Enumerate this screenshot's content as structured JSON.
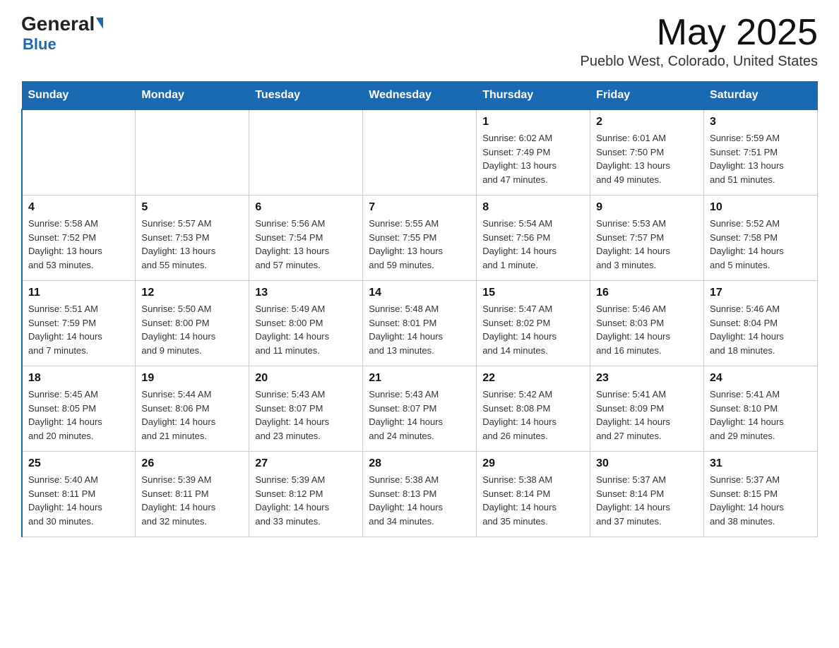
{
  "header": {
    "logo_general": "General",
    "logo_blue": "Blue",
    "month_title": "May 2025",
    "location": "Pueblo West, Colorado, United States"
  },
  "days_of_week": [
    "Sunday",
    "Monday",
    "Tuesday",
    "Wednesday",
    "Thursday",
    "Friday",
    "Saturday"
  ],
  "weeks": [
    [
      {
        "day": "",
        "info": ""
      },
      {
        "day": "",
        "info": ""
      },
      {
        "day": "",
        "info": ""
      },
      {
        "day": "",
        "info": ""
      },
      {
        "day": "1",
        "info": "Sunrise: 6:02 AM\nSunset: 7:49 PM\nDaylight: 13 hours\nand 47 minutes."
      },
      {
        "day": "2",
        "info": "Sunrise: 6:01 AM\nSunset: 7:50 PM\nDaylight: 13 hours\nand 49 minutes."
      },
      {
        "day": "3",
        "info": "Sunrise: 5:59 AM\nSunset: 7:51 PM\nDaylight: 13 hours\nand 51 minutes."
      }
    ],
    [
      {
        "day": "4",
        "info": "Sunrise: 5:58 AM\nSunset: 7:52 PM\nDaylight: 13 hours\nand 53 minutes."
      },
      {
        "day": "5",
        "info": "Sunrise: 5:57 AM\nSunset: 7:53 PM\nDaylight: 13 hours\nand 55 minutes."
      },
      {
        "day": "6",
        "info": "Sunrise: 5:56 AM\nSunset: 7:54 PM\nDaylight: 13 hours\nand 57 minutes."
      },
      {
        "day": "7",
        "info": "Sunrise: 5:55 AM\nSunset: 7:55 PM\nDaylight: 13 hours\nand 59 minutes."
      },
      {
        "day": "8",
        "info": "Sunrise: 5:54 AM\nSunset: 7:56 PM\nDaylight: 14 hours\nand 1 minute."
      },
      {
        "day": "9",
        "info": "Sunrise: 5:53 AM\nSunset: 7:57 PM\nDaylight: 14 hours\nand 3 minutes."
      },
      {
        "day": "10",
        "info": "Sunrise: 5:52 AM\nSunset: 7:58 PM\nDaylight: 14 hours\nand 5 minutes."
      }
    ],
    [
      {
        "day": "11",
        "info": "Sunrise: 5:51 AM\nSunset: 7:59 PM\nDaylight: 14 hours\nand 7 minutes."
      },
      {
        "day": "12",
        "info": "Sunrise: 5:50 AM\nSunset: 8:00 PM\nDaylight: 14 hours\nand 9 minutes."
      },
      {
        "day": "13",
        "info": "Sunrise: 5:49 AM\nSunset: 8:00 PM\nDaylight: 14 hours\nand 11 minutes."
      },
      {
        "day": "14",
        "info": "Sunrise: 5:48 AM\nSunset: 8:01 PM\nDaylight: 14 hours\nand 13 minutes."
      },
      {
        "day": "15",
        "info": "Sunrise: 5:47 AM\nSunset: 8:02 PM\nDaylight: 14 hours\nand 14 minutes."
      },
      {
        "day": "16",
        "info": "Sunrise: 5:46 AM\nSunset: 8:03 PM\nDaylight: 14 hours\nand 16 minutes."
      },
      {
        "day": "17",
        "info": "Sunrise: 5:46 AM\nSunset: 8:04 PM\nDaylight: 14 hours\nand 18 minutes."
      }
    ],
    [
      {
        "day": "18",
        "info": "Sunrise: 5:45 AM\nSunset: 8:05 PM\nDaylight: 14 hours\nand 20 minutes."
      },
      {
        "day": "19",
        "info": "Sunrise: 5:44 AM\nSunset: 8:06 PM\nDaylight: 14 hours\nand 21 minutes."
      },
      {
        "day": "20",
        "info": "Sunrise: 5:43 AM\nSunset: 8:07 PM\nDaylight: 14 hours\nand 23 minutes."
      },
      {
        "day": "21",
        "info": "Sunrise: 5:43 AM\nSunset: 8:07 PM\nDaylight: 14 hours\nand 24 minutes."
      },
      {
        "day": "22",
        "info": "Sunrise: 5:42 AM\nSunset: 8:08 PM\nDaylight: 14 hours\nand 26 minutes."
      },
      {
        "day": "23",
        "info": "Sunrise: 5:41 AM\nSunset: 8:09 PM\nDaylight: 14 hours\nand 27 minutes."
      },
      {
        "day": "24",
        "info": "Sunrise: 5:41 AM\nSunset: 8:10 PM\nDaylight: 14 hours\nand 29 minutes."
      }
    ],
    [
      {
        "day": "25",
        "info": "Sunrise: 5:40 AM\nSunset: 8:11 PM\nDaylight: 14 hours\nand 30 minutes."
      },
      {
        "day": "26",
        "info": "Sunrise: 5:39 AM\nSunset: 8:11 PM\nDaylight: 14 hours\nand 32 minutes."
      },
      {
        "day": "27",
        "info": "Sunrise: 5:39 AM\nSunset: 8:12 PM\nDaylight: 14 hours\nand 33 minutes."
      },
      {
        "day": "28",
        "info": "Sunrise: 5:38 AM\nSunset: 8:13 PM\nDaylight: 14 hours\nand 34 minutes."
      },
      {
        "day": "29",
        "info": "Sunrise: 5:38 AM\nSunset: 8:14 PM\nDaylight: 14 hours\nand 35 minutes."
      },
      {
        "day": "30",
        "info": "Sunrise: 5:37 AM\nSunset: 8:14 PM\nDaylight: 14 hours\nand 37 minutes."
      },
      {
        "day": "31",
        "info": "Sunrise: 5:37 AM\nSunset: 8:15 PM\nDaylight: 14 hours\nand 38 minutes."
      }
    ]
  ]
}
